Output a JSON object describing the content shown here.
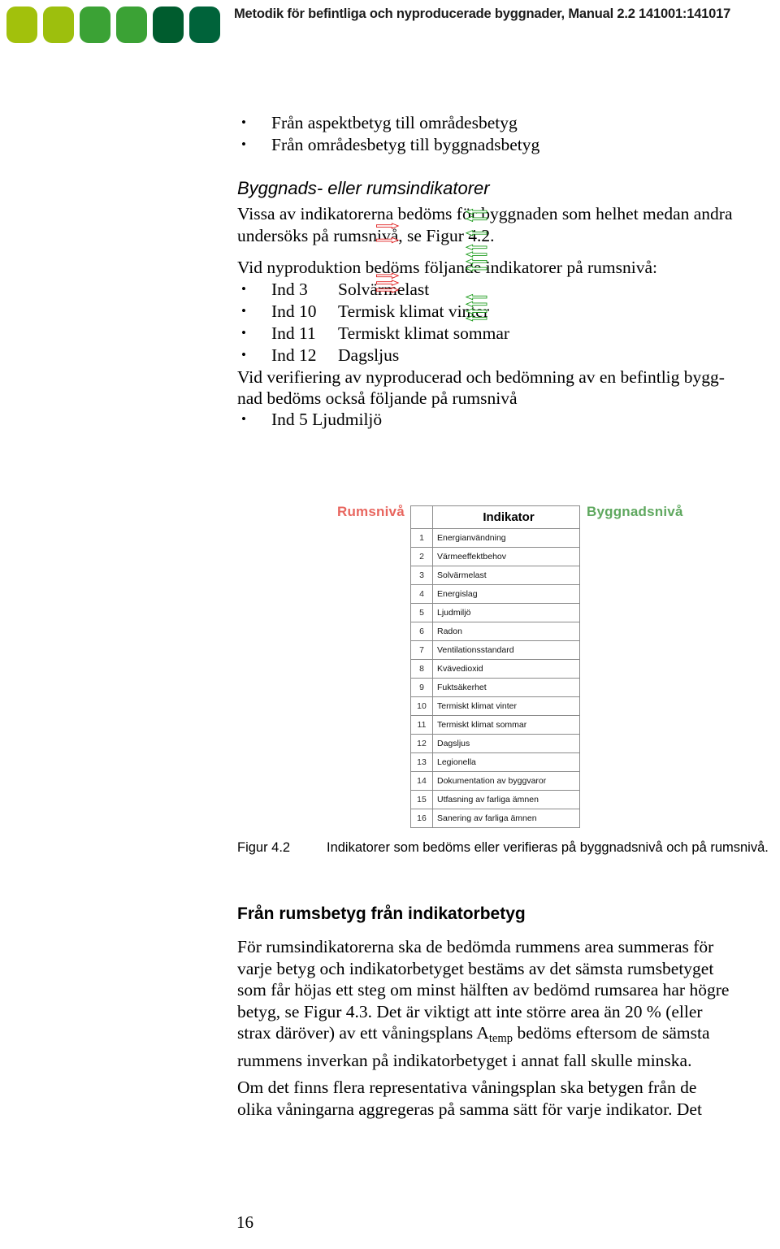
{
  "header": {
    "title": "Metodik för befintliga och nyproducerade byggnader, Manual 2.2 141001:141017",
    "logo_colors": [
      "#a2c10c",
      "#9dbf0d",
      "#3ba235",
      "#3ba235",
      "#005c2e",
      "#00633a"
    ]
  },
  "top_bullets": [
    {
      "text": "Från aspektbetyg till områdesbetyg"
    },
    {
      "text": "Från områdesbetyg till byggnadsbetyg"
    }
  ],
  "section_building_or_room": {
    "subhead": "Byggnads- eller rumsindikatorer",
    "paragraph_line1": "Vissa av indikatorerna bedöms för byggnaden som helhet medan andra",
    "paragraph_line2": "undersöks på rumsnivå, se Figur 4.2."
  },
  "newproduction": {
    "intro": "Vid nyproduktion bedöms följande indikatorer på rumsnivå:",
    "items": [
      {
        "code": "Ind 3",
        "label": "Solvärmelast"
      },
      {
        "code": "Ind 10",
        "label": "Termisk klimat vinter"
      },
      {
        "code": "Ind 11",
        "label": "Termiskt klimat sommar"
      },
      {
        "code": "Ind 12",
        "label": "Dagsljus"
      }
    ]
  },
  "verification": {
    "line1": "Vid verifiering av nyproducerad och bedömning av en befintlig bygg-",
    "line2": "nad bedöms också följande på rumsnivå",
    "items": [
      {
        "text": "Ind 5 Ljudmiljö"
      }
    ]
  },
  "figure": {
    "left_label": "Rumsnivå",
    "right_label": "Byggnadsnivå",
    "left_label_color": "#e8665f",
    "right_label_color": "#5fa85f",
    "room_arrow_color": "#e01b1b",
    "building_arrow_color": "#1a9a1a",
    "table_header": {
      "num": "",
      "name": "Indikator"
    },
    "rows": [
      {
        "num": "1",
        "name": "Energianvändning",
        "room": false,
        "building": true
      },
      {
        "num": "2",
        "name": "Värmeeffektbehov",
        "room": false,
        "building": true
      },
      {
        "num": "3",
        "name": "Solvärmelast",
        "room": true,
        "building": false
      },
      {
        "num": "4",
        "name": "Energislag",
        "room": false,
        "building": true
      },
      {
        "num": "5",
        "name": "Ljudmiljö",
        "room": true,
        "building": false
      },
      {
        "num": "6",
        "name": "Radon",
        "room": false,
        "building": true
      },
      {
        "num": "7",
        "name": "Ventilationsstandard",
        "room": false,
        "building": true
      },
      {
        "num": "8",
        "name": "Kvävedioxid",
        "room": false,
        "building": true
      },
      {
        "num": "9",
        "name": "Fuktsäkerhet",
        "room": false,
        "building": true
      },
      {
        "num": "10",
        "name": "Termiskt klimat vinter",
        "room": true,
        "building": false
      },
      {
        "num": "11",
        "name": "Termiskt klimat sommar",
        "room": true,
        "building": false
      },
      {
        "num": "12",
        "name": "Dagsljus",
        "room": true,
        "building": false
      },
      {
        "num": "13",
        "name": "Legionella",
        "room": false,
        "building": true
      },
      {
        "num": "14",
        "name": "Dokumentation av byggvaror",
        "room": false,
        "building": true
      },
      {
        "num": "15",
        "name": "Utfasning av farliga ämnen",
        "room": false,
        "building": true
      },
      {
        "num": "16",
        "name": "Sanering av farliga ämnen",
        "room": false,
        "building": true
      }
    ],
    "caption_number": "Figur 4.2",
    "caption_text": "Indikatorer som bedöms eller verifieras på byggnadsnivå och på rumsnivå."
  },
  "section_rumsbetyg": {
    "heading": "Från rumsbetyg från indikatorbetyg",
    "paragraph1_lines": [
      "För rumsindikatorerna ska de bedömda rummens area summeras för",
      "varje betyg och indikatorbetyget bestäms av det sämsta rumsbetyget",
      "som får höjas ett steg om minst hälften av bedömd rumsarea har högre",
      "betyg, se Figur 4.3. Det är viktigt att inte större area än 20 % (eller"
    ],
    "paragraph1_line5_a": "strax däröver) av ett våningsplans A",
    "paragraph1_line5_sub": "temp",
    "paragraph1_line5_b": " bedöms eftersom de sämsta",
    "paragraph1_line6": "rummens inverkan på indikatorbetyget i annat fall skulle minska.",
    "paragraph2_lines": [
      "Om det finns flera representativa våningsplan ska betygen från de",
      "olika våningarna aggregeras på samma sätt för varje indikator. Det"
    ]
  },
  "footer": {
    "page_number": "16"
  }
}
